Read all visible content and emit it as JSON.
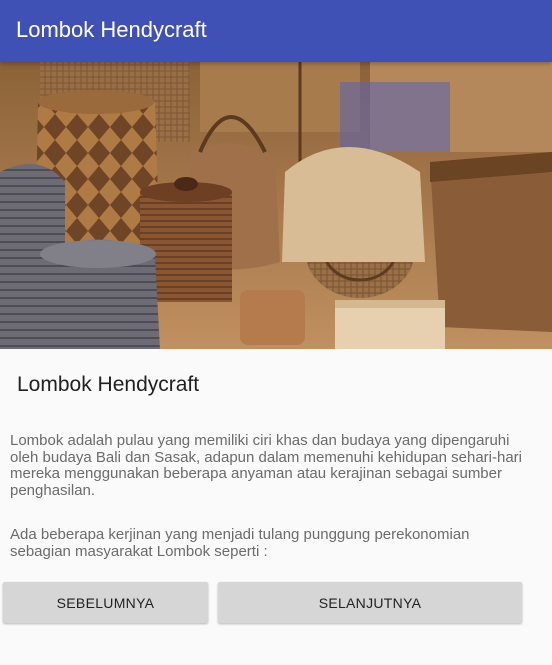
{
  "app_bar": {
    "title": "Lombok Hendycraft"
  },
  "hero_image": {
    "subject": "woven rattan and bamboo handicraft baskets"
  },
  "content": {
    "heading": "Lombok Hendycraft",
    "paragraphs": [
      "Lombok adalah pulau yang memiliki ciri khas dan budaya yang dipengaruhi oleh budaya Bali dan Sasak, adapun dalam memenuhi kehidupan sehari-hari mereka menggunakan beberapa anyaman atau kerajinan sebagai sumber penghasilan.",
      "Ada beberapa kerjinan yang menjadi tulang punggung perekonomian sebagian masyarakat Lombok seperti :"
    ]
  },
  "buttons": {
    "previous": "SEBELUMNYA",
    "next": "SELANJUTNYA"
  },
  "colors": {
    "app_bar": "#3f51b5",
    "background": "#fafafa",
    "button": "#d6d6d6"
  }
}
